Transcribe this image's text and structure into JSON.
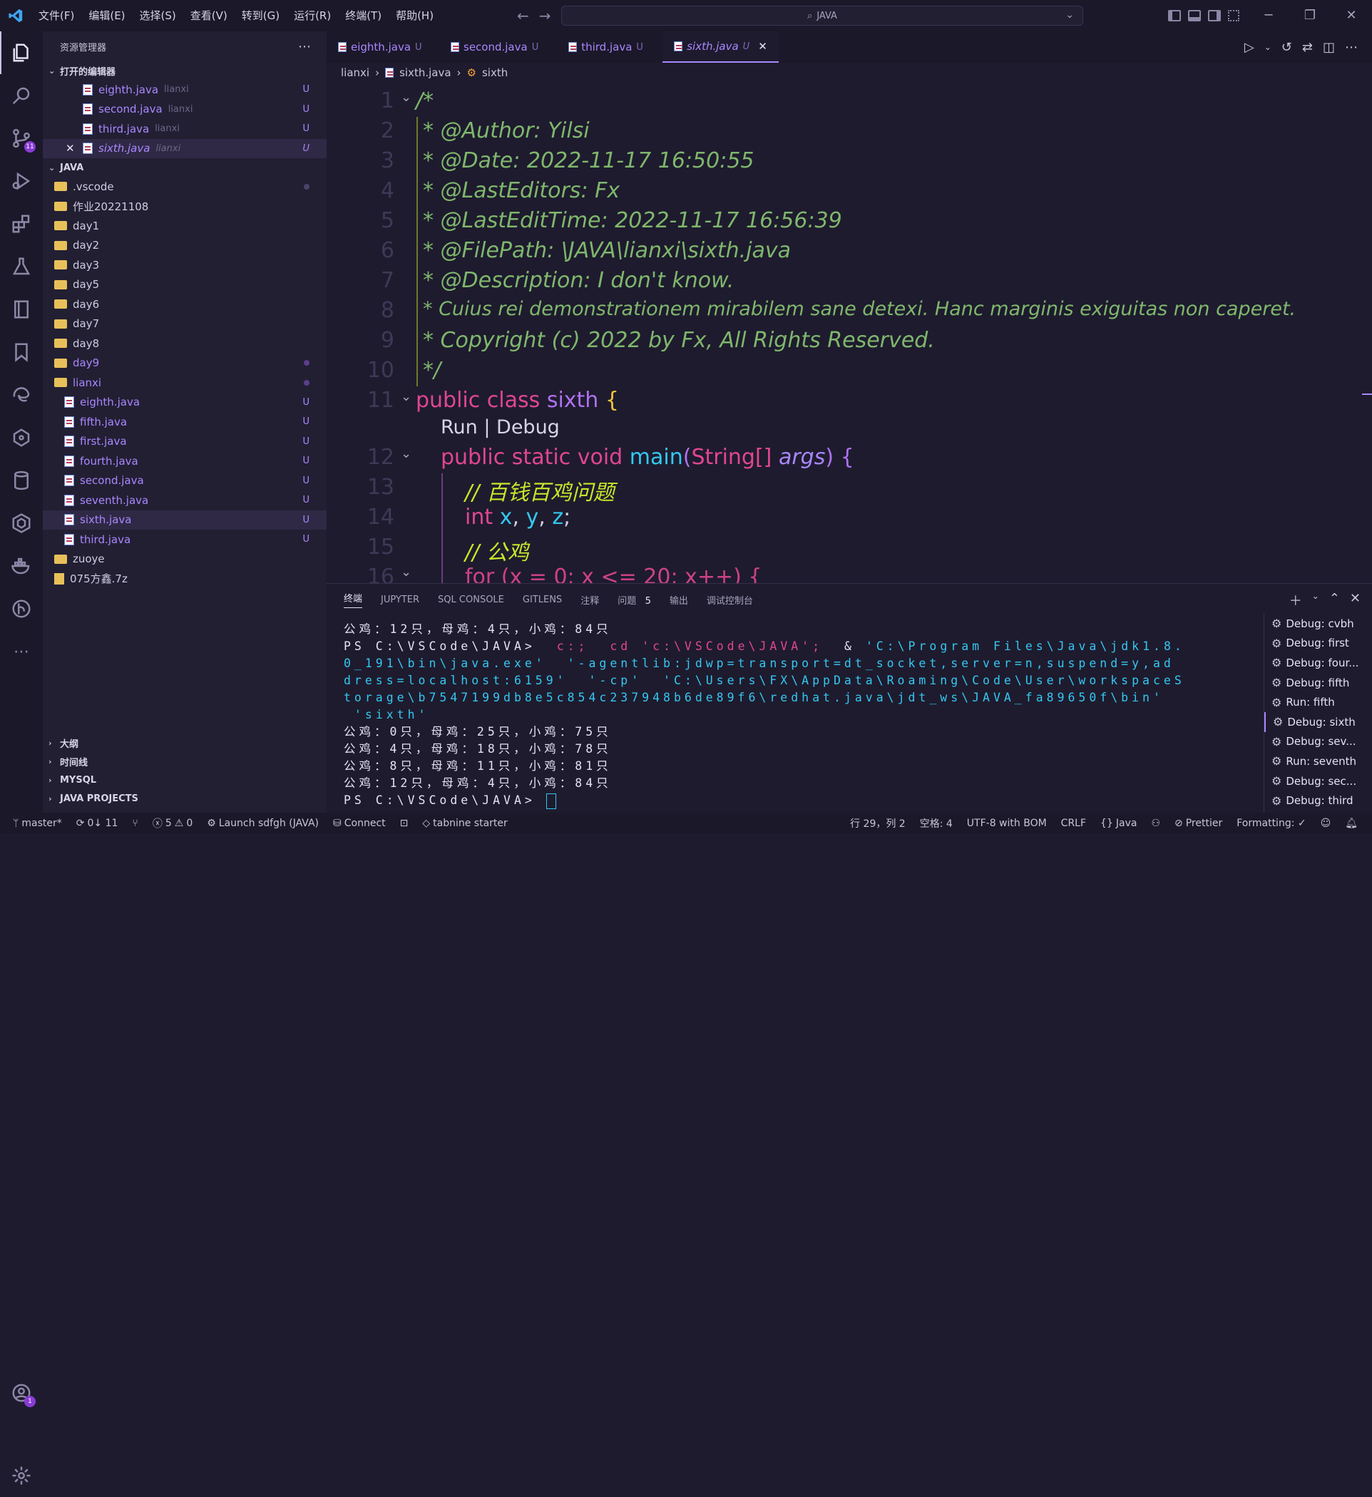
{
  "title_bar": {
    "menus": [
      "文件(F)",
      "编辑(E)",
      "选择(S)",
      "查看(V)",
      "转到(G)",
      "运行(R)",
      "终端(T)",
      "帮助(H)"
    ],
    "search": "JAVA"
  },
  "sidebar": {
    "title": "资源管理器",
    "open_editors_title": "打开的编辑器",
    "open_editors": [
      {
        "name": "eighth.java",
        "dir": "lianxi",
        "status": "U"
      },
      {
        "name": "second.java",
        "dir": "lianxi",
        "status": "U"
      },
      {
        "name": "third.java",
        "dir": "lianxi",
        "status": "U"
      },
      {
        "name": "sixth.java",
        "dir": "lianxi",
        "status": "U"
      }
    ],
    "workspace_title": "JAVA",
    "folders": [
      ".vscode",
      "作业20221108",
      "day1",
      "day2",
      "day3",
      "day5",
      "day6",
      "day7",
      "day8",
      "day9",
      "lianxi"
    ],
    "lianxi_files": [
      {
        "name": "eighth.java",
        "status": "U"
      },
      {
        "name": "fifth.java",
        "status": "U"
      },
      {
        "name": "first.java",
        "status": "U"
      },
      {
        "name": "fourth.java",
        "status": "U"
      },
      {
        "name": "second.java",
        "status": "U"
      },
      {
        "name": "seventh.java",
        "status": "U"
      },
      {
        "name": "sixth.java",
        "status": "U"
      },
      {
        "name": "third.java",
        "status": "U"
      }
    ],
    "after": [
      "zuoye",
      "075方鑫.7z"
    ],
    "bottom_sections": [
      "大纲",
      "时间线",
      "MYSQL",
      "JAVA PROJECTS"
    ],
    "source_control_badge": "11",
    "account_badge": "1"
  },
  "tabs": [
    {
      "name": "eighth.java",
      "status": "U"
    },
    {
      "name": "second.java",
      "status": "U"
    },
    {
      "name": "third.java",
      "status": "U"
    },
    {
      "name": "sixth.java",
      "status": "U"
    }
  ],
  "breadcrumb": {
    "folder": "lianxi",
    "file": "sixth.java",
    "symbol": "sixth"
  },
  "editor": {
    "line_numbers": [
      "1",
      "2",
      "3",
      "4",
      "5",
      "6",
      "7",
      "8",
      "9",
      "10",
      "11",
      "12",
      "13",
      "14",
      "15",
      "16"
    ],
    "comment_lines": [
      "/*",
      "* @Author: Yilsi",
      "* @Date: 2022-11-17 16:50:55",
      "* @LastEditors: Fx",
      "* @LastEditTime: 2022-11-17 16:56:39",
      "* @FilePath: \\JAVA\\lianxi\\sixth.java",
      "* @Description: I don't know.",
      "* Cuius rei demonstrationem mirabilem sane detexi. Hanc marginis exiguitas non caperet.",
      "* Copyright (c) 2022 by Fx, All Rights Reserved.",
      "*/"
    ],
    "class_kw": "public class",
    "class_name": "sixth",
    "codelens": "Run | Debug",
    "main_kw": "public static void",
    "main_name": "main",
    "main_param_type": "String[]",
    "main_param": "args",
    "comment_13": "// 百钱百鸡问题",
    "int_kw": "int",
    "comment_15": "// 公鸡",
    "for_line": "for (x = 0; x <= 20; x++) {"
  },
  "panel": {
    "tabs": [
      "终端",
      "JUPYTER",
      "SQL CONSOLE",
      "GITLENS",
      "注释",
      "问题",
      "输出",
      "调试控制台"
    ],
    "problems_count": "5",
    "terminal": {
      "line1": "公鸡：12只，母鸡：4只，小鸡：84只",
      "prompt": "PS C:\\VSCode\\JAVA>",
      "cmd_c": "c:;",
      "cmd_cd": "cd 'c:\\VSCode\\JAVA';",
      "cmd_amp": "&",
      "cmd_rest1": "'C:\\Program Files\\Java\\jdk1.8.",
      "cmd_rest2": "0_191\\bin\\java.exe'  '-agentlib:jdwp=transport=dt_socket,server=n,suspend=y,ad",
      "cmd_rest3": "dress=localhost:6159'  '-cp'  'C:\\Users\\FX\\AppData\\Roaming\\Code\\User\\workspaceS",
      "cmd_rest4": "torage\\b7547199db8e5c854c237948b6de89f6\\redhat.java\\jdt_ws\\JAVA_fa89650f\\bin'",
      "cmd_rest5": " 'sixth'",
      "out1": "公鸡：0只，母鸡：25只，小鸡：75只",
      "out2": "公鸡：4只，母鸡：18只，小鸡：78只",
      "out3": "公鸡：8只，母鸡：11只，小鸡：81只",
      "out4": "公鸡：12只，母鸡：4只，小鸡：84只",
      "prompt2": "PS C:\\VSCode\\JAVA>"
    },
    "terminal_list": [
      "Debug: cvbh",
      "Debug: first",
      "Debug: four...",
      "Debug: fifth",
      "Run: fifth",
      "Debug: sixth",
      "Debug: sev...",
      "Run: seventh",
      "Debug: sec...",
      "Debug: third"
    ]
  },
  "statusbar": {
    "branch": "master*",
    "sync": "0↓ 11",
    "errors": "5",
    "warnings": "0",
    "launch": "Launch sdfgh (JAVA)",
    "connect": "Connect",
    "tabnine": "tabnine starter",
    "position": "行 29，列 2",
    "spaces": "空格: 4",
    "encoding": "UTF-8 with BOM",
    "eol": "CRLF",
    "language": "Java",
    "prettier": "Prettier",
    "formatting": "Formatting: ✓"
  },
  "colors": {
    "accent": "#a987ff",
    "keyword": "#e0478f",
    "function": "#34c8f0",
    "comment": "#7fb76c",
    "bracket": "#f2c53a"
  }
}
